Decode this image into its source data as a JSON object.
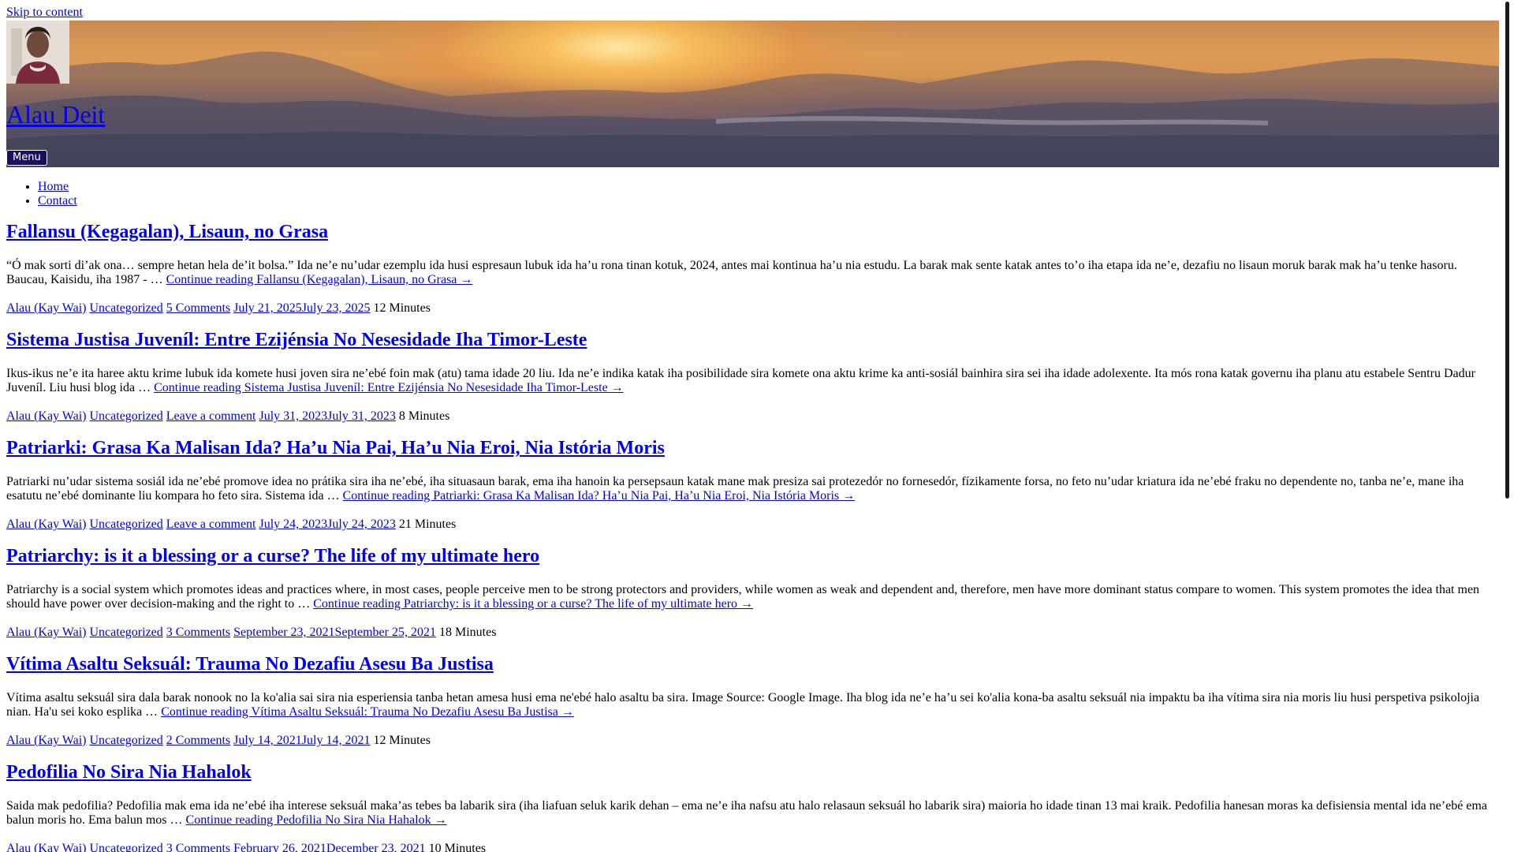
{
  "skip_link": "Skip to content",
  "site": {
    "title": "Alau Deit",
    "menu_label": "Menu"
  },
  "nav": {
    "items": [
      "Home",
      "Contact"
    ]
  },
  "posts": [
    {
      "title": "Fallansu (Kegagalan), Lisaun, no Grasa",
      "excerpt": "“Ó mak sorti di’ak ona… sempre hetan hela de’it bolsa.” Ida ne’e nu’udar ezemplu ida husi espresaun lubuk ida ha’u rona tinan kotuk, 2024, antes mai kontinua ha’u nia estudu. La barak mak sente katak antes to’o iha etapa ida ne’e, dezafiu no lisaun moruk barak mak ha’u tenke hasoru. Baucau, Kaisidu, iha 1987 - …",
      "continue": "Continue reading Fallansu (Kegagalan), Lisaun, no Grasa →",
      "author": "Alau (Kay Wai)",
      "category": "Uncategorized",
      "comments": "5 Comments",
      "dates": "July 21, 2025July 23, 2025",
      "read_time": "12 Minutes"
    },
    {
      "title": "Sistema Justisa Juveníl: Entre Ezijénsia No Nesesidade Iha Timor-Leste",
      "excerpt": "Ikus-ikus ne’e ita haree aktu krime lubuk ida komete husi joven sira ne’ebé foin mak (atu) tama idade 20 liu. Ida ne’e indika katak iha posibilidade sira komete ona aktu krime ka anti-sosiál bainhira sira sei iha idade adolexente. Ita mós rona katak governu iha planu atu estabele Sentru Dadur Juveníl. Liu husi blog ida …",
      "continue": "Continue reading Sistema Justisa Juveníl: Entre Ezijénsia No Nesesidade Iha Timor-Leste →",
      "author": "Alau (Kay Wai)",
      "category": "Uncategorized",
      "comments": "Leave a comment",
      "dates": "July 31, 2023July 31, 2023",
      "read_time": "8 Minutes"
    },
    {
      "title": "Patriarki: Grasa Ka Malisan Ida? Ha’u Nia Pai, Ha’u Nia Eroi, Nia Istória Moris",
      "excerpt": "Patriarki nu’udar sistema sosiál ida ne’ebé promove idea no prátika sira iha ne’ebé, iha situasaun barak, ema iha hanoin ka persepsaun katak mane mak presiza sai protezedór no fornesedór, fízikamente forsa, no feto nu’udar kriatura ida ne’ebé fraku no dependente no, tanba ne’e, mane iha esatutu ne’ebé dominante liu kompara ho feto sira. Sistema ida …",
      "continue": "Continue reading Patriarki: Grasa Ka Malisan Ida? Ha’u Nia Pai, Ha’u Nia Eroi, Nia Istória Moris →",
      "author": "Alau (Kay Wai)",
      "category": "Uncategorized",
      "comments": "Leave a comment",
      "dates": "July 24, 2023July 24, 2023",
      "read_time": "21 Minutes"
    },
    {
      "title": "Patriarchy: is it a blessing or a curse? The life of my ultimate hero",
      "excerpt": "Patriarchy is a social system which promotes ideas and practices where, in most cases, people perceive men to be strong protectors and providers, while women as weak and dependent and, therefore, men have more dominant status compare to women. This system promotes the idea that men should have power over decision-making and the right to …",
      "continue": "Continue reading Patriarchy: is it a blessing or a curse? The life of my ultimate hero →",
      "author": "Alau (Kay Wai)",
      "category": "Uncategorized",
      "comments": "3 Comments",
      "dates": "September 23, 2021September 25, 2021",
      "read_time": "18 Minutes"
    },
    {
      "title": "Vítima Asaltu Seksuál: Trauma No Dezafiu Asesu Ba Justisa",
      "excerpt": "Vítima asaltu seksuál sira dala barak nonook no la ko'alia sai sira nia esperiensia tanba hetan amesa husi ema ne'ebé halo asaltu ba sira. Image Source: Google Image. Iha blog ida ne’e ha’u sei ko'alia kona-ba asaltu seksuál nia impaktu ba iha vítima sira nia moris liu husi perspetiva psikolojia nian. Ha'u sei koko esplika …",
      "continue": "Continue reading Vítima Asaltu Seksuál: Trauma No Dezafiu Asesu Ba Justisa →",
      "author": "Alau (Kay Wai)",
      "category": "Uncategorized",
      "comments": "2 Comments",
      "dates": "July 14, 2021July 14, 2021",
      "read_time": "12 Minutes"
    },
    {
      "title": "Pedofilia No Sira Nia Hahalok",
      "excerpt": "Saida mak pedofilia? Pedofilia mak ema ida ne’ebé iha interese seksuál maka’as tebes ba labarik sira (iha liafuan seluk karik dehan – ema ne’e iha nafsu atu halo relasaun seksuál ho labarik sira) maioria ho idade tinan 13 mai kraik. Pedofilia hanesan moras ka defisiensia mental ida ne’ebé  ema balun moris ho. Ema balun mos …",
      "continue": "Continue reading Pedofilia No Sira Nia Hahalok →",
      "author": "Alau (Kay Wai)",
      "category": "Uncategorized",
      "comments": "3 Comments",
      "dates": "February 26, 2021December 23, 2021",
      "read_time": "10 Minutes"
    }
  ]
}
